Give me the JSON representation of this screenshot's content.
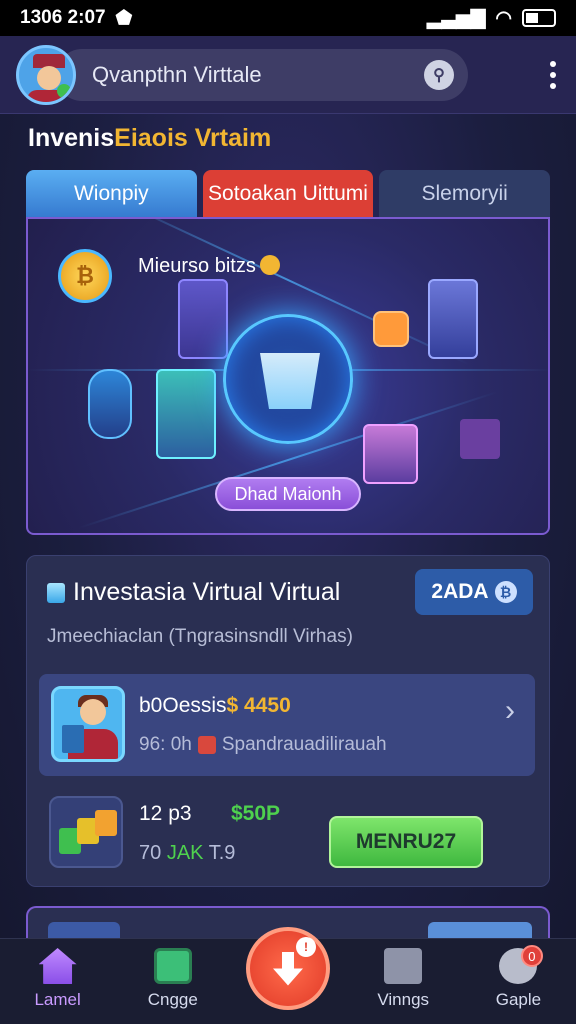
{
  "statusbar": {
    "time": "1306 2:07"
  },
  "header": {
    "search_text": "Qvanpthn Virttale"
  },
  "section": {
    "title_part1": "Invenis",
    "title_part2": "Eiaois Vrtaim"
  },
  "tabs": [
    {
      "label": "Wionpiy"
    },
    {
      "label": "Sotoakan Uittumi"
    },
    {
      "label": "Slemoryii"
    }
  ],
  "hero": {
    "label": "Mieurso bitzs",
    "button": "Dhad Maionh"
  },
  "card": {
    "title": "Investasia Virtual Virtual",
    "badge": "2ADA",
    "subtitle": "Jmeechiaclan (Tngrasinsndll Virhas)",
    "row1": {
      "title_prefix": "b0Oessis",
      "title_amount": "$ 4450",
      "sub_prefix": "96: 0h",
      "sub_text": "Spandrauadilirauah"
    },
    "row2": {
      "num": "12 p3",
      "value": "$50P",
      "sub_prefix": "70",
      "sub_green": "JAK",
      "sub_suffix": "T.9",
      "button": "MENRU27"
    }
  },
  "nav": [
    {
      "label": "Lamel"
    },
    {
      "label": "Cngge"
    },
    {
      "label": ""
    },
    {
      "label": "Vinngs"
    },
    {
      "label": "Gaple"
    }
  ],
  "colors": {
    "accent_gold": "#f2b632",
    "tab_active_red": "#dc3f35",
    "green": "#4ed14e",
    "purple": "#8a4fd8"
  }
}
